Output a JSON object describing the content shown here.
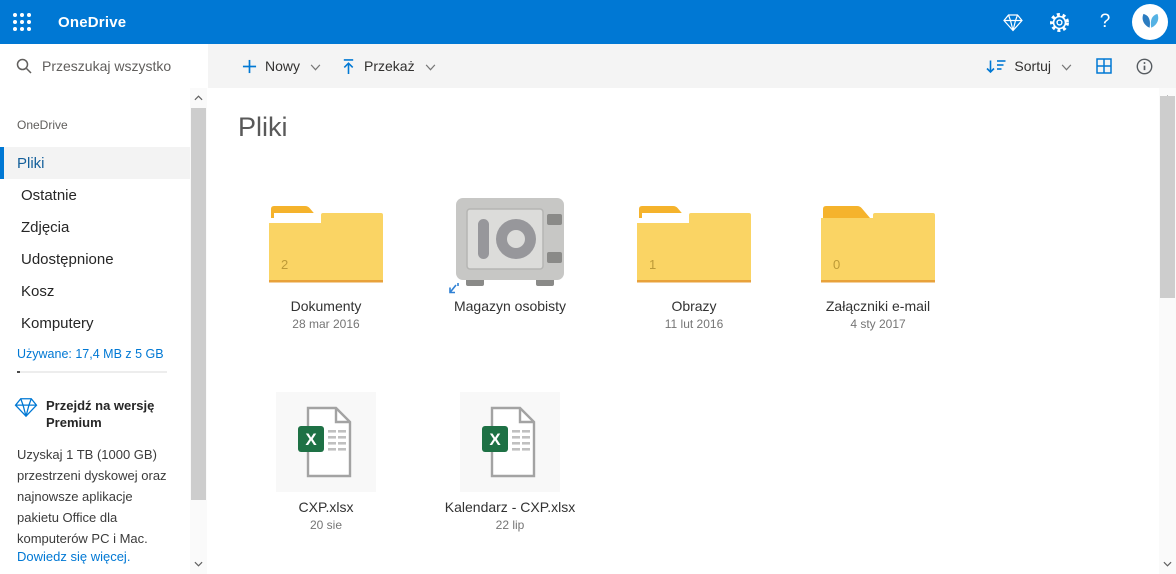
{
  "topbar": {
    "app_title": "OneDrive",
    "help_label": "?"
  },
  "search": {
    "placeholder": "Przeszukaj wszystko"
  },
  "toolbar": {
    "new_label": "Nowy",
    "upload_label": "Przekaż",
    "sort_label": "Sortuj"
  },
  "sidebar": {
    "section_label": "OneDrive",
    "items": [
      {
        "label": "Pliki",
        "selected": true
      },
      {
        "label": "Ostatnie",
        "selected": false
      },
      {
        "label": "Zdjęcia",
        "selected": false
      },
      {
        "label": "Udostępnione",
        "selected": false
      },
      {
        "label": "Kosz",
        "selected": false
      },
      {
        "label": "Komputery",
        "selected": false
      }
    ],
    "usage_text": "Używane: 17,4 MB z 5 GB",
    "premium": {
      "title": "Przejdź na wersję Premium",
      "body": "Uzyskaj 1 TB (1000 GB) przestrzeni dyskowej oraz najnowsze aplikacje pakietu Office dla komputerów PC i Mac.",
      "link": "Dowiedz się więcej."
    }
  },
  "main": {
    "heading": "Pliki",
    "tiles": [
      {
        "type": "folder",
        "name": "Dokumenty",
        "date": "28 mar 2016",
        "count": "2"
      },
      {
        "type": "vault",
        "name": "Magazyn osobisty",
        "date": ""
      },
      {
        "type": "folder",
        "name": "Obrazy",
        "date": "11 lut 2016",
        "count": "1"
      },
      {
        "type": "folder",
        "name": "Załączniki e-mail",
        "date": "4 sty 2017",
        "count": "0"
      },
      {
        "type": "xlsx",
        "name": "CXP.xlsx",
        "date": "20 sie"
      },
      {
        "type": "xlsx",
        "name": "Kalendarz - CXP.xlsx",
        "date": "22 lip"
      }
    ]
  },
  "colors": {
    "accent": "#0078d4",
    "folder_body": "#fad464",
    "folder_tab": "#f5b32c",
    "excel_green": "#1e7145",
    "toolbar_bg": "#f4f4f4"
  }
}
